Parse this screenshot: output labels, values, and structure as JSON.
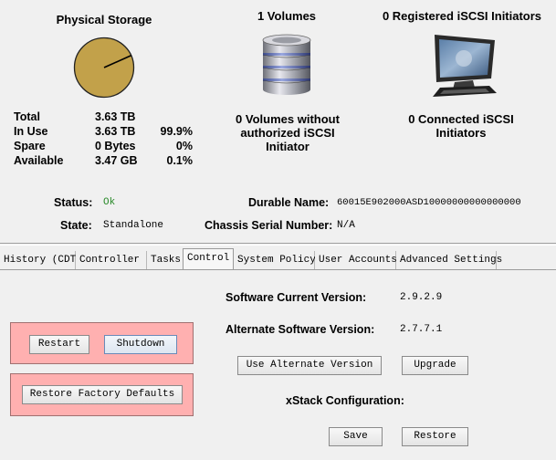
{
  "storage": {
    "title": "Physical Storage",
    "used_fraction": 0.999,
    "rows": [
      {
        "label": "Total",
        "value": "3.63 TB",
        "percent": ""
      },
      {
        "label": "In Use",
        "value": "3.63 TB",
        "percent": "99.9%"
      },
      {
        "label": "Spare",
        "value": "0 Bytes",
        "percent": "0%"
      },
      {
        "label": "Available",
        "value": "3.47 GB",
        "percent": "0.1%"
      }
    ],
    "pie_color": "#c2a14a"
  },
  "volumes": {
    "title": "1 Volumes",
    "icon": "database-icon",
    "note_line1": "0 Volumes without",
    "note_line2": "authorized iSCSI",
    "note_line3": "Initiator"
  },
  "initiators": {
    "title": "0 Registered iSCSI Initiators",
    "icon": "monitor-icon",
    "connected_line1": "0 Connected iSCSI",
    "connected_line2": "Initiators"
  },
  "status": {
    "status_label": "Status:",
    "status_value": "Ok",
    "status_color": "#2a8a2a",
    "state_label": "State:",
    "state_value": "Standalone",
    "durable_label": "Durable Name:",
    "durable_value": "60015E902000ASD10000000000000000",
    "serial_label": "Chassis Serial Number:",
    "serial_value": "N/A"
  },
  "tabs": [
    {
      "label": "History (CDT)",
      "active": false
    },
    {
      "label": "Controller",
      "active": false
    },
    {
      "label": "Tasks",
      "active": false
    },
    {
      "label": "Control",
      "active": true
    },
    {
      "label": "System Policy",
      "active": false
    },
    {
      "label": "User Accounts",
      "active": false
    },
    {
      "label": "Advanced Settings",
      "active": false
    }
  ],
  "control": {
    "restart_label": "Restart",
    "shutdown_label": "Shutdown",
    "restore_defaults_label": "Restore Factory Defaults",
    "current_version_label": "Software Current Version:",
    "current_version_value": "2.9.2.9",
    "alternate_version_label": "Alternate Software Version:",
    "alternate_version_value": "2.7.7.1",
    "use_alternate_label": "Use Alternate Version",
    "upgrade_label": "Upgrade",
    "xstack_label": "xStack Configuration:",
    "save_label": "Save",
    "restore_label": "Restore"
  }
}
